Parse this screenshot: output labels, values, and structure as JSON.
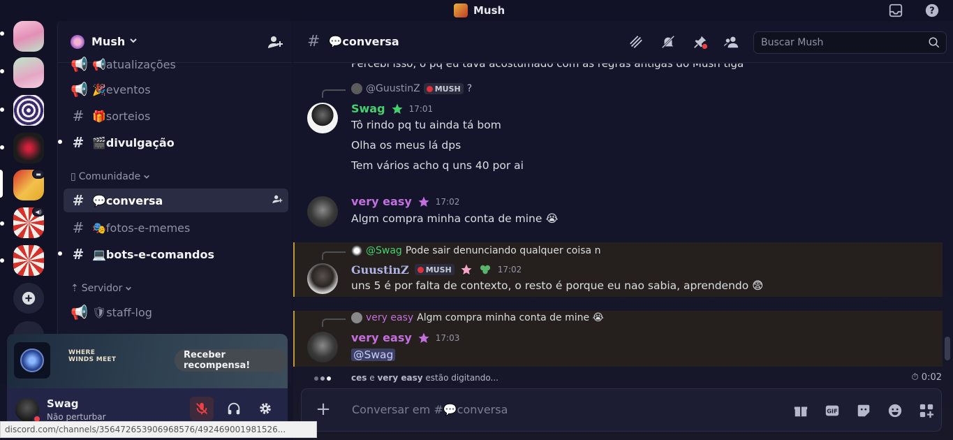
{
  "titlebar": {
    "title": "Mush"
  },
  "guild": {
    "name": "Mush"
  },
  "sidebar": {
    "channels": [
      {
        "label": "📢atualizações",
        "prefix": "📢",
        "kind": "announce",
        "state": "muted"
      },
      {
        "label": "🎉eventos",
        "kind": "announce",
        "state": "muted"
      },
      {
        "label": "🎁sorteios",
        "kind": "text",
        "state": "muted"
      },
      {
        "label": "🎬divulgação",
        "kind": "text",
        "state": "unread"
      },
      {
        "label": "💬conversa",
        "kind": "text",
        "state": "active"
      },
      {
        "label": "🎭fotos-e-memes",
        "kind": "text",
        "state": "muted"
      },
      {
        "label": "💻bots-e-comandos",
        "kind": "text",
        "state": "unread"
      },
      {
        "label": "🛡staff-log",
        "kind": "announce",
        "state": "muted"
      }
    ],
    "categories": [
      {
        "label": "Comunidade",
        "icon": "▯"
      },
      {
        "label": "Servidor",
        "icon": "⇡"
      }
    ]
  },
  "promo": {
    "game_name_line1": "WHERE",
    "game_name_line2": "WINDS MEET",
    "cta": "Receber recompensa!"
  },
  "user": {
    "name": "Swag",
    "status": "Não perturbar",
    "status_color": "#f23f43"
  },
  "browser": {
    "status_url": "discord.com/channels/356472653906968576/492469001981526..."
  },
  "chat": {
    "channel_title": "💬conversa",
    "search_placeholder": "Buscar Mush",
    "cut_line": "Percebi isso, o pq eu tava acostumado com as regras antigas do Mush tiga",
    "messages": [
      {
        "reply_to": "@GuustinZ",
        "reply_tag": "MUSH",
        "reply_text": "?",
        "author": "Swag",
        "author_color": "#43d16e",
        "time": "17:01",
        "lines": [
          "Tô rindo pq tu ainda tá bom",
          "Olha os meus lá dps",
          "Tem vários acho q uns 40 por ai"
        ]
      },
      {
        "author": "very easy",
        "author_color": "#c36fdd",
        "time": "17:02",
        "lines": [
          "Algm compra minha conta de mine 😭"
        ]
      },
      {
        "reply_to": "@Swag",
        "reply_text": "Pode sair denunciando qualquer coisa n",
        "author": "GuustinZ",
        "author_color": "#b0b4e6",
        "author_tag": "MUSH",
        "time": "17:02",
        "lines": [
          "uns 5 é por falta de contexto, o resto é porque eu nao sabia, aprendendo 😨"
        ]
      },
      {
        "reply_to": "very easy",
        "reply_text": "Algm compra minha conta de mine 😭",
        "author": "very easy",
        "author_color": "#c36fdd",
        "time": "17:03",
        "mention": "@Swag"
      }
    ],
    "typing_user1": "ces",
    "typing_conj": "e",
    "typing_user2": "very easy",
    "typing_suffix": "estão digitando...",
    "slowmode": "0:02",
    "composer_placeholder": "Conversar em #💬conversa"
  }
}
